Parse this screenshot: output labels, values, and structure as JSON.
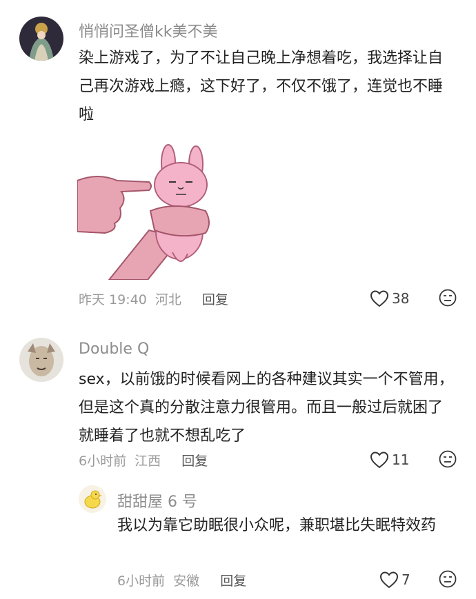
{
  "comments": [
    {
      "username": "悄悄问圣僧kk美不美",
      "text": "染上游戏了，为了不让自己晚上净想着吃，我选择让自己再次游戏上瘾，这下好了，不仅不饿了，连觉也不睡啦",
      "time": "昨天 19:40",
      "location": "河北",
      "reply_label": "回复",
      "likes": "38"
    },
    {
      "username": "Double Q",
      "text": "sex，以前饿的时候看网上的各种建议其实一个不管用，但是这个真的分散注意力很管用。而且一般过后就困了就睡着了也就不想乱吃了",
      "time": "6小时前",
      "location": "江西",
      "reply_label": "回复",
      "likes": "11"
    },
    {
      "username": "甜甜屋 6 号",
      "text": "我以为靠它助眠很小众呢，兼职堪比失眠特效药",
      "time": "6小时前",
      "location": "安徽",
      "reply_label": "回复",
      "likes": "7"
    }
  ],
  "icons": {
    "like": "heart-outline-icon",
    "reaction": "neutral-face-icon",
    "sticker": "pink-bunny-pointing-finger-sticker"
  },
  "colors": {
    "username": "#8c8c8c",
    "text": "#222222",
    "meta": "#9a9a9a",
    "sticker_pink": "#f2a7c4"
  }
}
